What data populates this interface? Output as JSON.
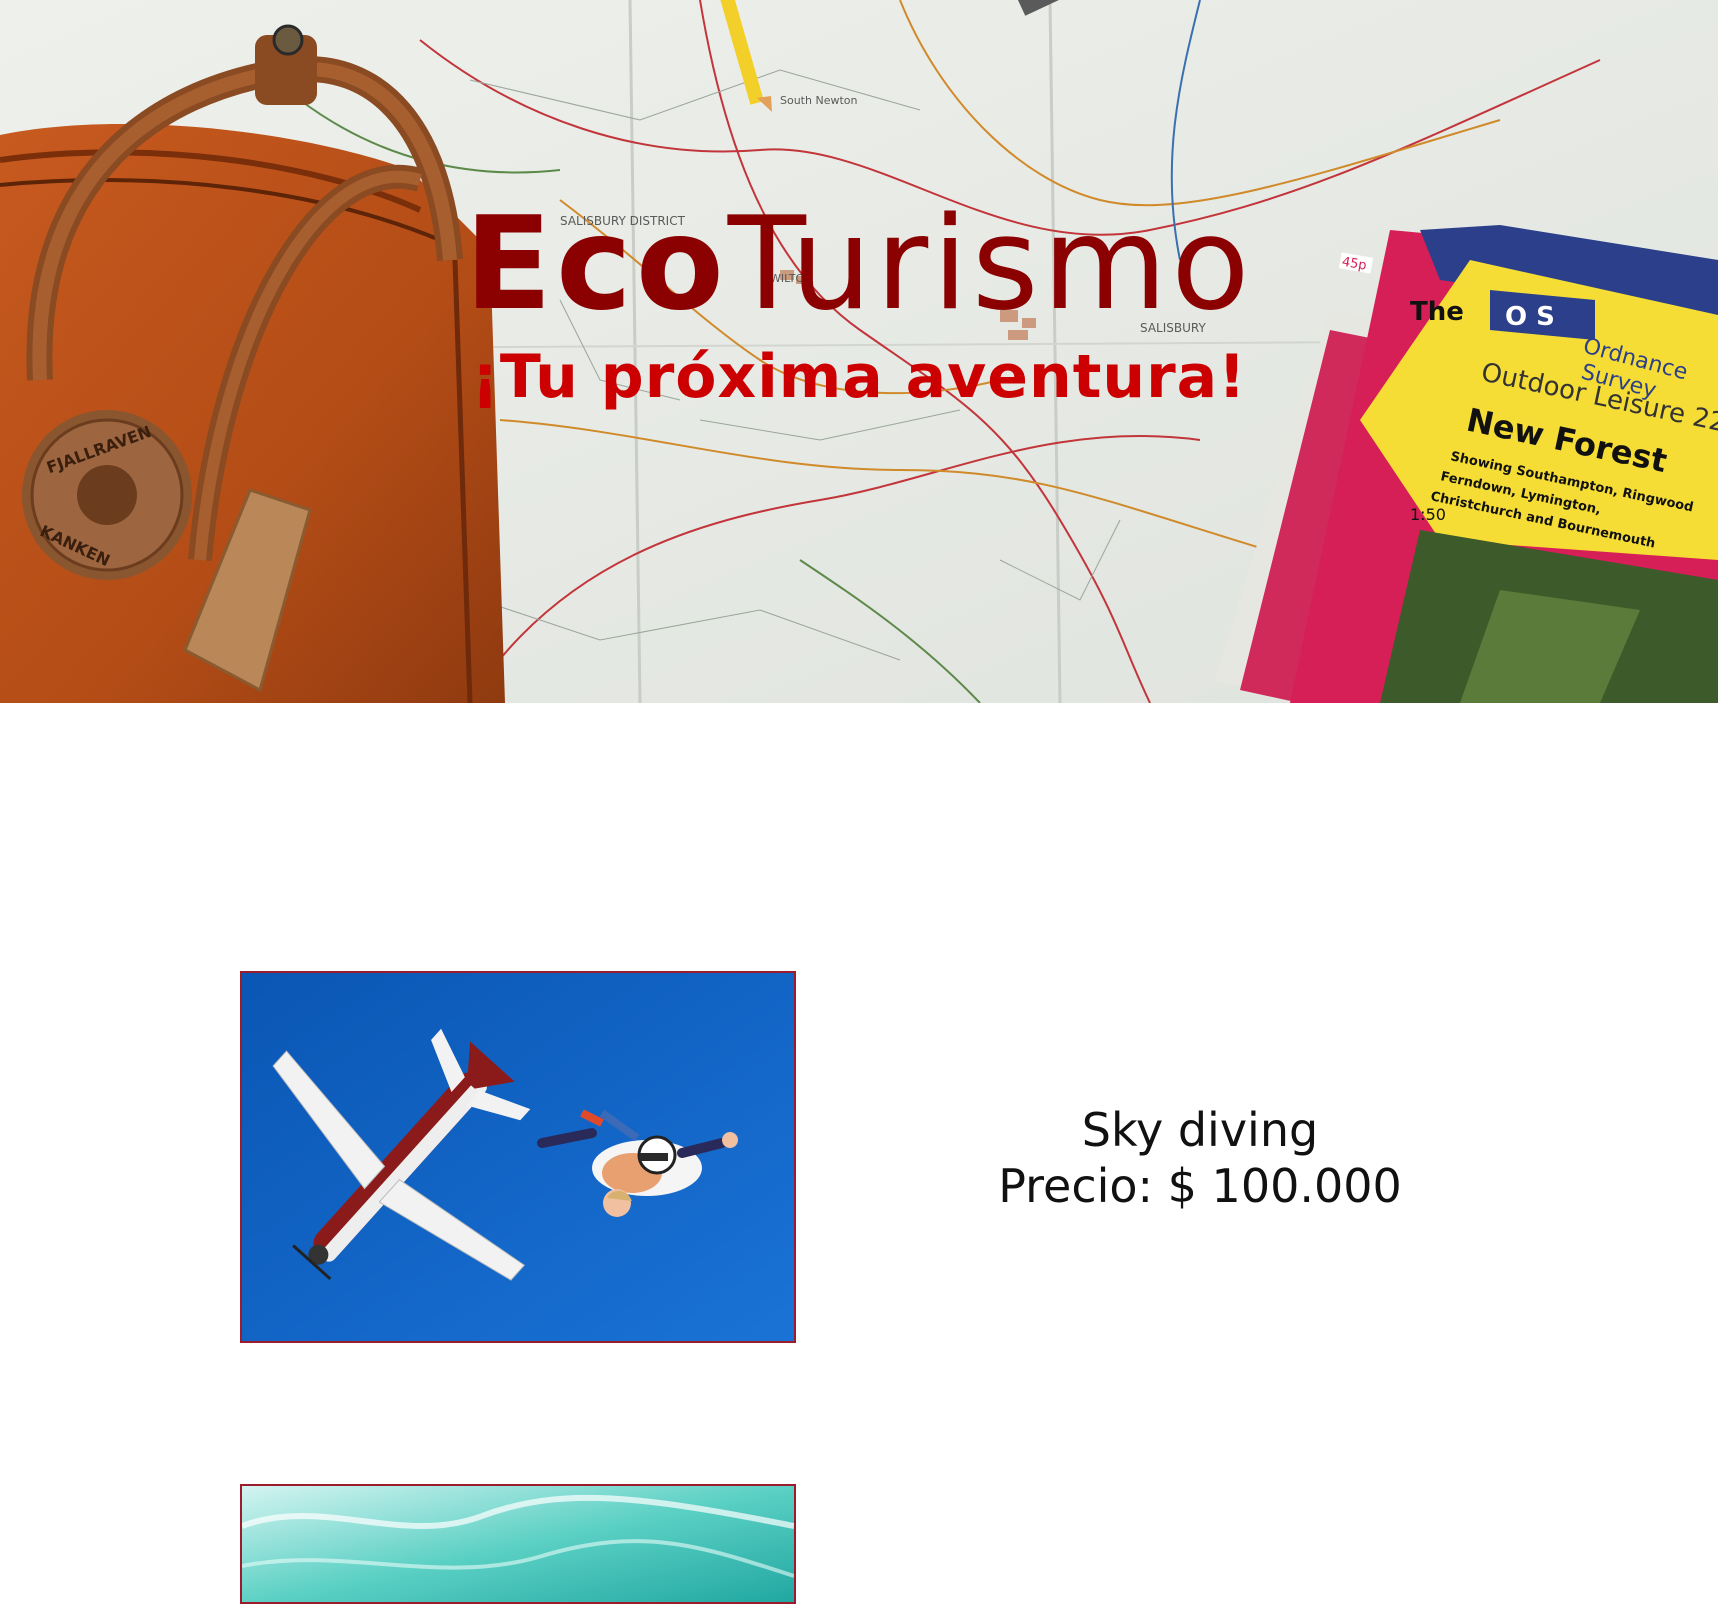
{
  "hero": {
    "title_bold": "Eco",
    "title_rest": "Turismo",
    "subtitle": "¡Tu próxima aventura!",
    "map_labels": [
      "SALISBURY",
      "SALISBURY DISTRICT",
      "WILTON",
      "South Newton"
    ],
    "backpack_badge": [
      "FJALLRAVEN",
      "KANKEN"
    ],
    "map_cover": {
      "price": "45p",
      "brand": [
        "Ordnance",
        "Survey"
      ],
      "series": "Outdoor Leisure 22",
      "area": "New Forest",
      "details": "Showing Southampton, Ringwood Ferndown, Lymington, Christchurch and Bournemouth",
      "scale": "1:50"
    }
  },
  "products": [
    {
      "name": "Sky diving",
      "price": "Precio: $ 100.000"
    }
  ],
  "colors": {
    "title": "#8b0000",
    "subtitle": "#cc0000",
    "image_border": "#9b1c2c",
    "sky": "#0a5fc0",
    "water": "#5bd0c4"
  }
}
